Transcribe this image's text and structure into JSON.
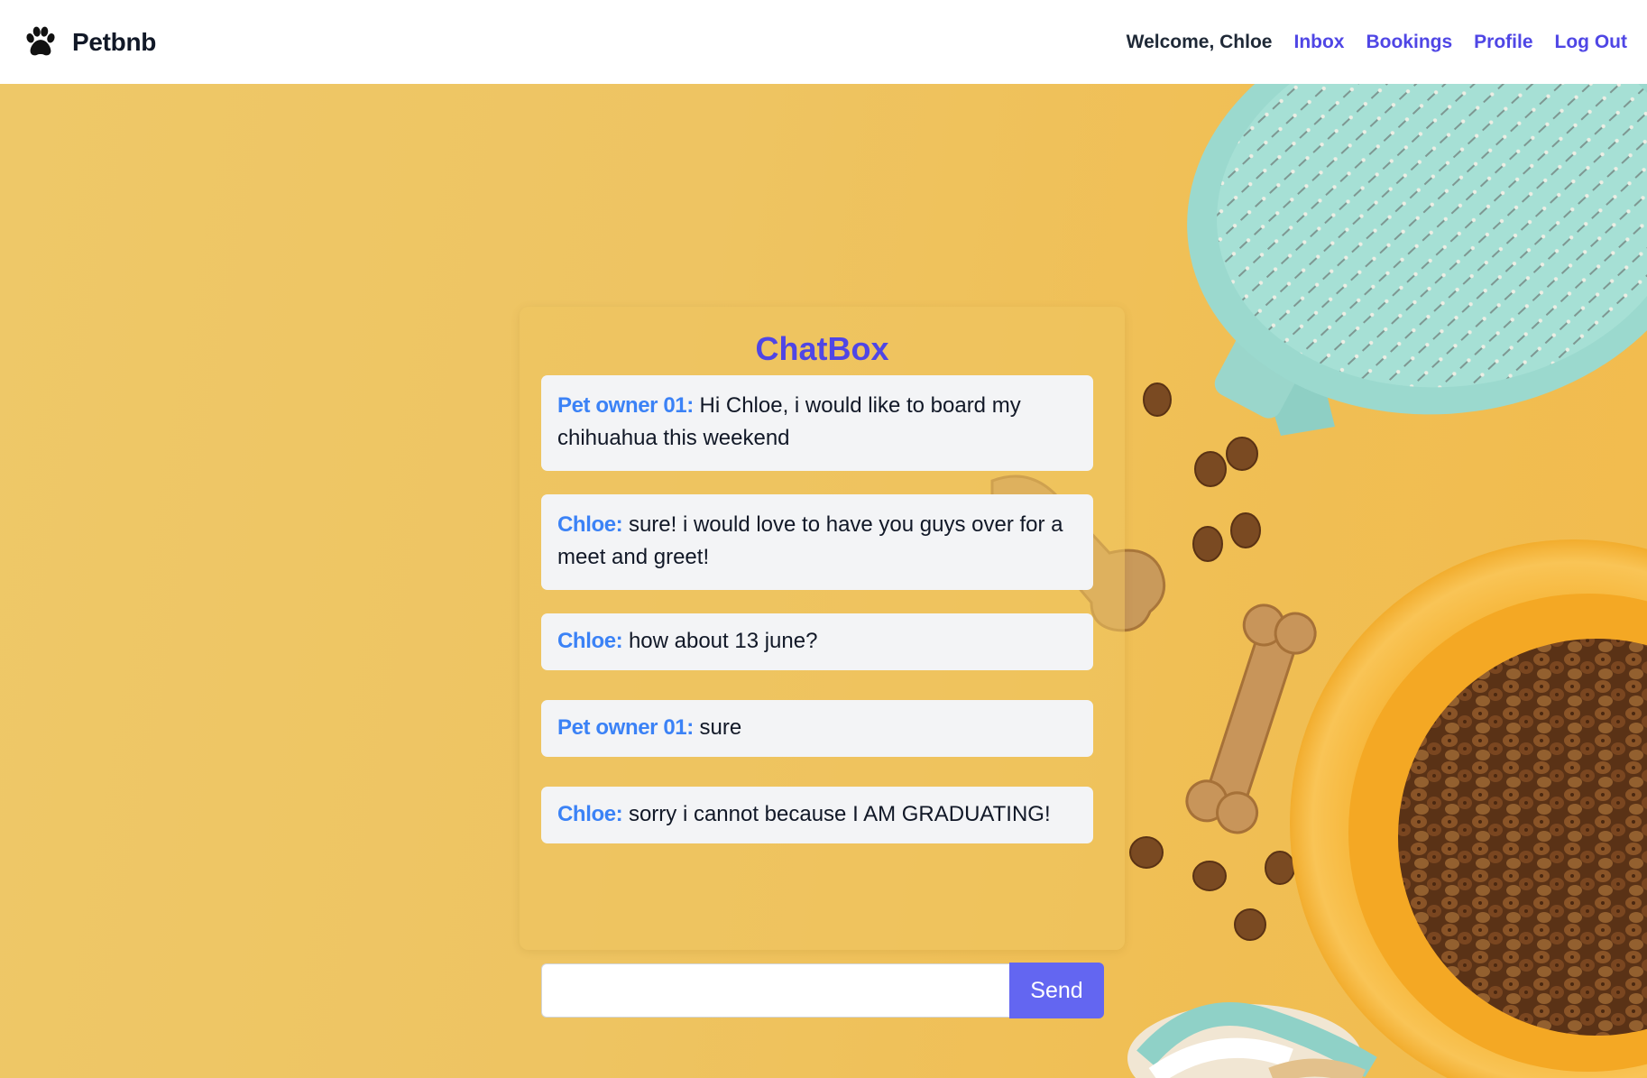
{
  "brand": {
    "name": "Petbnb",
    "logo_icon": "paw-icon"
  },
  "nav": {
    "welcome": "Welcome, Chloe",
    "links": [
      "Inbox",
      "Bookings",
      "Profile",
      "Log Out"
    ]
  },
  "chat": {
    "title": "ChatBox",
    "messages": [
      {
        "sender": "Pet owner 01:",
        "text": "Hi Chloe, i would like to board my chihuahua this weekend"
      },
      {
        "sender": "Chloe:",
        "text": "sure! i would love to have you guys over for a meet and greet!"
      },
      {
        "sender": "Chloe:",
        "text": "how about 13 june?"
      },
      {
        "sender": "Pet owner 01:",
        "text": "sure"
      },
      {
        "sender": "Chloe:",
        "text": "sorry i cannot because I AM GRADUATING!"
      }
    ],
    "input_value": "",
    "send_label": "Send"
  },
  "colors": {
    "accent": "#4f46e5",
    "sender": "#3b82f6",
    "send_button": "#6366f1",
    "background": "#efc460"
  }
}
